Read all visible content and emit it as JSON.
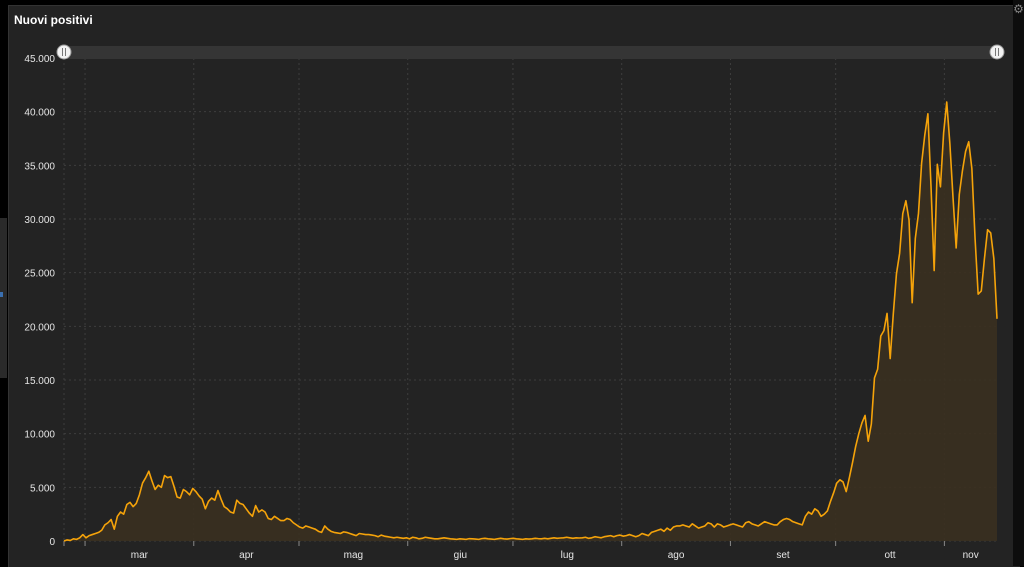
{
  "panel": {
    "title": "Nuovi positivi"
  },
  "colors": {
    "background": "#232323",
    "line": "#f5a30a",
    "fill": "#3a3020",
    "grid": "#3e3e3e",
    "text": "#e6e6e6"
  },
  "icons": {
    "settings": "gear-icon"
  },
  "chart_data": {
    "type": "area",
    "title": "Nuovi positivi",
    "xlabel": "",
    "ylabel": "",
    "ylim": [
      0,
      45000
    ],
    "yticks": [
      0,
      5000,
      10000,
      15000,
      20000,
      25000,
      30000,
      35000,
      40000,
      45000
    ],
    "ytick_labels": [
      "0",
      "5.000",
      "10.000",
      "15.000",
      "20.000",
      "25.000",
      "30.000",
      "35.000",
      "40.000",
      "45.000"
    ],
    "xtick_labels": [
      "mar",
      "apr",
      "mag",
      "giu",
      "lug",
      "ago",
      "set",
      "ott",
      "nov"
    ],
    "x_start": "2020-02-24",
    "x_end": "2020-11-16",
    "grid": true,
    "range_slider": true,
    "series": [
      {
        "values": [
          0,
          100,
          50,
          200,
          150,
          300,
          600,
          300,
          500,
          600,
          700,
          800,
          1000,
          1500,
          1700,
          2000,
          1100,
          2300,
          2700,
          2500,
          3400,
          3600,
          3200,
          3500,
          4300,
          5400,
          5900,
          6500,
          5600,
          4800,
          5200,
          5000,
          6100,
          5900,
          6000,
          5100,
          4100,
          4000,
          4800,
          4600,
          4300,
          4900,
          4600,
          4200,
          3900,
          3000,
          3700,
          4000,
          3800,
          4700,
          3900,
          3200,
          3000,
          2700,
          2600,
          3800,
          3500,
          3400,
          3000,
          2600,
          2300,
          3300,
          2700,
          2900,
          2700,
          2100,
          2000,
          2300,
          2100,
          1900,
          1900,
          2100,
          2000,
          1700,
          1500,
          1300,
          1200,
          1400,
          1300,
          1200,
          1100,
          900,
          800,
          1400,
          1100,
          900,
          800,
          750,
          700,
          850,
          800,
          700,
          600,
          500,
          700,
          650,
          600,
          600,
          550,
          500,
          400,
          550,
          450,
          400,
          350,
          300,
          350,
          300,
          250,
          300,
          200,
          350,
          300,
          200,
          250,
          350,
          300,
          250,
          200,
          200,
          250,
          300,
          250,
          200,
          180,
          150,
          200,
          180,
          150,
          220,
          200,
          180,
          150,
          220,
          250,
          200,
          180,
          150,
          200,
          250,
          200,
          180,
          220,
          250,
          200,
          180,
          150,
          200,
          180,
          200,
          250,
          220,
          200,
          250,
          200,
          250,
          300,
          250,
          280,
          300,
          350,
          300,
          250,
          300,
          280,
          300,
          350,
          250,
          300,
          400,
          350,
          300,
          400,
          450,
          500,
          400,
          500,
          550,
          450,
          500,
          600,
          500,
          400,
          500,
          700,
          600,
          500,
          800,
          900,
          1000,
          1100,
          900,
          1200,
          1000,
          1300,
          1400,
          1400,
          1500,
          1400,
          1300,
          1600,
          1400,
          1200,
          1300,
          1400,
          1700,
          1600,
          1300,
          1600,
          1500,
          1300,
          1400,
          1500,
          1600,
          1500,
          1400,
          1300,
          1700,
          1800,
          1600,
          1500,
          1400,
          1600,
          1800,
          1700,
          1600,
          1500,
          1500,
          1800,
          2000,
          2100,
          2000,
          1800,
          1700,
          1600,
          1500,
          2300,
          2700,
          2500,
          3000,
          2800,
          2300,
          2500,
          2800,
          3700,
          4500,
          5400,
          5700,
          5500,
          4600,
          5900,
          7300,
          8800,
          10000,
          11000,
          11700,
          9300,
          10900,
          15200,
          16000,
          19100,
          19600,
          21200,
          17000,
          21200,
          24900,
          26800,
          30500,
          31700,
          29900,
          22200,
          28200,
          30500,
          35200,
          37800,
          39800,
          33000,
          25200,
          35100,
          33000,
          38000,
          40900,
          37000,
          32000,
          27300,
          32300,
          34500,
          36300,
          37200,
          34700,
          28300,
          23000,
          23300,
          26300,
          29000,
          28700,
          26300,
          20700
        ]
      }
    ]
  }
}
